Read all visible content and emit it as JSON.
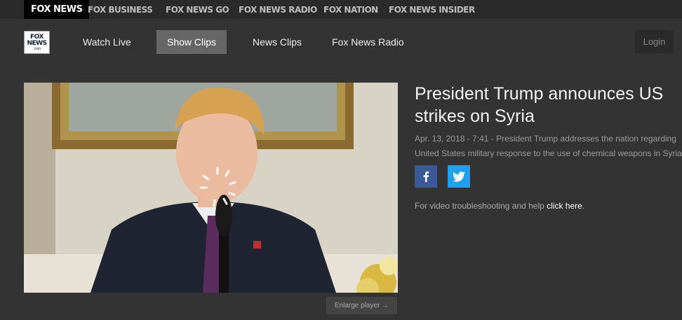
{
  "networks": [
    {
      "label": "FOX NEWS",
      "active": true
    },
    {
      "label": "FOX BUSINESS"
    },
    {
      "label": "FOX NEWS GO"
    },
    {
      "label": "FOX NEWS RADIO"
    },
    {
      "label": "FOX NATION"
    },
    {
      "label": "FOX NEWS INSIDER"
    }
  ],
  "logo": {
    "line1": "FOX",
    "line2": "NEWS",
    "line3": ".com"
  },
  "nav": {
    "watch_live": "Watch Live",
    "show_clips": "Show Clips",
    "news_clips": "News Clips",
    "fox_news_radio": "Fox News Radio",
    "login": "Login"
  },
  "video": {
    "enlarge_label": "Enlarge player →",
    "title": "President Trump announces US strikes on Syria",
    "meta_line1": "Apr. 13, 2018 - 7:41 - President Trump addresses the nation regarding",
    "meta_line2": "United States military response to the use of chemical weapons in Syria"
  },
  "social": {
    "facebook": "facebook-icon",
    "twitter": "twitter-icon"
  },
  "help": {
    "text": "For video troubleshooting and help ",
    "link": "click here",
    "end": "."
  },
  "colors": {
    "page_bg": "#333333",
    "facebook": "#3b5998",
    "twitter": "#1da1f2"
  }
}
